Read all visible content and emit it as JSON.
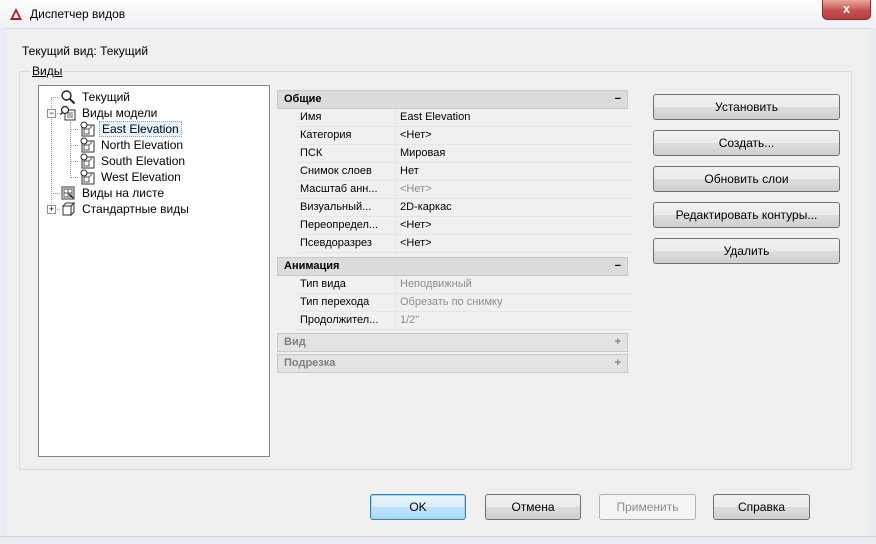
{
  "window": {
    "title": "Диспетчер видов",
    "close_label": "x"
  },
  "current_view": "Текущий вид: Текущий",
  "views_group_label": "Виды",
  "tree": {
    "current": "Текущий",
    "model_views": "Виды модели",
    "model_children": [
      "East Elevation",
      "North Elevation",
      "South Elevation",
      "West Elevation"
    ],
    "layout_views": "Виды на листе",
    "preset_views": "Стандартные виды"
  },
  "properties": {
    "general": {
      "title": "Общие",
      "toggle": "−",
      "rows": [
        {
          "name": "Имя",
          "value": "East Elevation",
          "disabled": false
        },
        {
          "name": "Категория",
          "value": "<Нет>",
          "disabled": false
        },
        {
          "name": "ПСК",
          "value": "Мировая",
          "disabled": false
        },
        {
          "name": "Снимок слоев",
          "value": "Нет",
          "disabled": false
        },
        {
          "name": "Масштаб анн...",
          "value": "<Нет>",
          "disabled": true
        },
        {
          "name": "Визуальный...",
          "value": "2D-каркас",
          "disabled": false
        },
        {
          "name": "Переопредел...",
          "value": "<Нет>",
          "disabled": false
        },
        {
          "name": "Псевдоразрез",
          "value": "<Нет>",
          "disabled": false
        }
      ]
    },
    "animation": {
      "title": "Анимация",
      "toggle": "−",
      "rows": [
        {
          "name": "Тип вида",
          "value": "Неподвижный",
          "disabled": true
        },
        {
          "name": "Тип перехода",
          "value": "Обрезать по снимку",
          "disabled": true
        },
        {
          "name": "Продолжител...",
          "value": "1/2\"",
          "disabled": true
        }
      ]
    },
    "view": {
      "title": "Вид",
      "toggle": "+"
    },
    "clipping": {
      "title": "Подрезка",
      "toggle": "+"
    }
  },
  "side_buttons": {
    "set_current": "Установить",
    "new": "Создать...",
    "update_layers": "Обновить слои",
    "edit_boundaries": "Редактировать контуры...",
    "delete": "Удалить"
  },
  "bottom_buttons": {
    "ok": "OK",
    "cancel": "Отмена",
    "apply": "Применить",
    "help": "Справка"
  },
  "colors": {
    "accent": "#3c7fb1",
    "selection": "#e5f1fb",
    "close": "#c75050",
    "disabled_text": "#8d8d8d"
  }
}
